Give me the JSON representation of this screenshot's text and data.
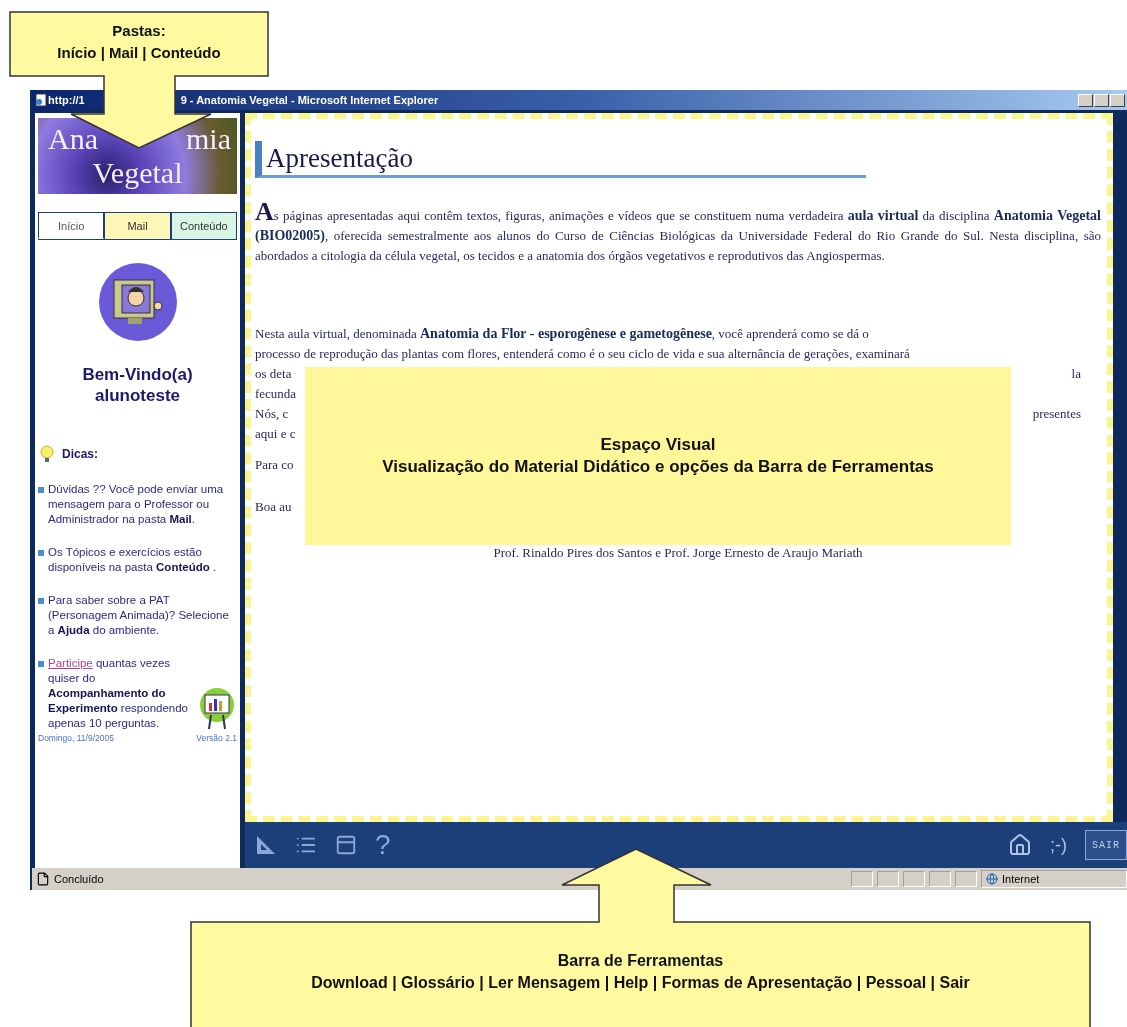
{
  "window": {
    "title_left": "http://1",
    "title_right": "9 - Anatomia Vegetal - Microsoft Internet Explorer"
  },
  "sidebar": {
    "logo": {
      "line1_left": "Ana",
      "line1_right": "mia",
      "line2": "Vegetal"
    },
    "tabs": [
      {
        "label": "Início",
        "selected": true,
        "color": "#ffffff"
      },
      {
        "label": "Mail",
        "selected": false,
        "color": "#fdf6b4"
      },
      {
        "label": "Conteúdo",
        "selected": false,
        "color": "#d9f5e4"
      }
    ],
    "welcome": "Bem-Vindo(a)",
    "user": "alunoteste",
    "tips_title": "Dicas:",
    "tips": [
      {
        "text": "Dúvidas ?? Você pode enviar uma mensagem para o Professor ou Administrador na pasta **Mail**."
      },
      {
        "text": "Os Tópicos e exercícios estão disponíveis na pasta **Conteúdo** ."
      },
      {
        "text": "Para saber sobre a PAT (Personagem Animada)? Selecione a **Ajuda** do ambiente."
      },
      {
        "link": "Participe",
        "text": " quantas vezes quiser do **Acompanhamento do Experimento** respondendo apenas 10 perguntas."
      }
    ],
    "date": "Domingo, 11/9/2005",
    "version": "Versão 2.1"
  },
  "content": {
    "heading": "Apresentação",
    "paragraph": "As páginas apresentadas aqui contêm textos, figuras, animações e vídeos que se constituem numa verdadeira **aula virtual** da disciplina **Anatomia Vegetal (BIO02005)**, oferecida semestralmente aos alunos do Curso de Ciências Biológicas da Universidade Federal do Rio Grande do Sul. Nesta disciplina, são abordados a citologia da célula vegetal, os tecidos e a anatomia dos órgãos vegetativos e reprodutivos das Angiospermas.",
    "lines": [
      {
        "left": "Nesta aula virtual, denominada **Anatomia da Flor - esporogênese e gametogênese**, você aprenderá como se dá o"
      },
      {
        "left": "processo de reprodução das plantas com flores, entenderá como é o seu ciclo de vida e sua alternância de gerações, examinará"
      },
      {
        "left": "os deta",
        "right": "la"
      },
      {
        "left": "fecunda"
      },
      {
        "left": "Nós, c",
        "right": "presentes"
      },
      {
        "left": "aqui e c"
      }
    ],
    "short_lines": [
      "Para co",
      "Boa au"
    ],
    "signature": "Prof. Rinaldo Pires dos Santos e Prof. Jorge Ernesto de Araujo Mariath"
  },
  "toolbar": {
    "help": "?",
    "smiley": ";-)",
    "exit": "SAIR"
  },
  "status_bar": {
    "status": "Concluído",
    "zone": "Internet"
  },
  "callouts": [
    {
      "title": "Pastas:",
      "text": "Início | Mail | Conteúdo"
    },
    {
      "title": "Espaço Visual",
      "text": "Visualização do Material Didático e opções da Barra de Ferramentas"
    },
    {
      "title": "Barra de Ferramentas",
      "text": "Download | Glossário | Ler Mensagem | Help | Formas de Apresentação | Pessoal | Sair"
    }
  ]
}
